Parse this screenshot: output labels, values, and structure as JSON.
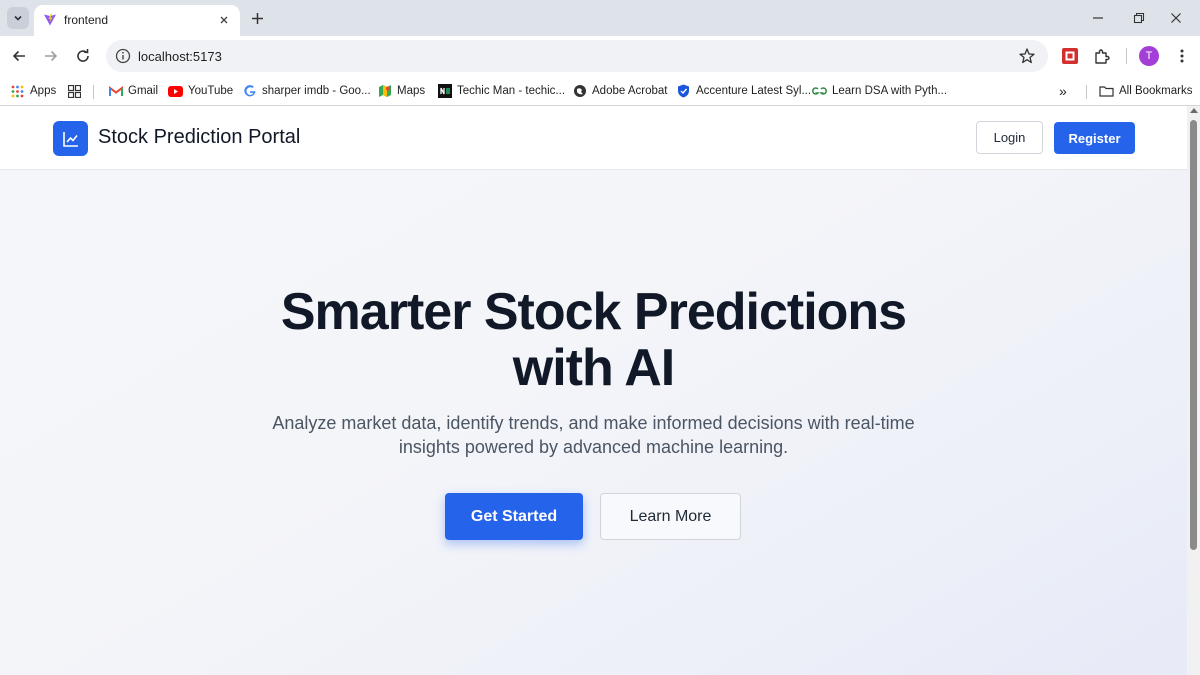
{
  "browser": {
    "tab_title": "frontend",
    "url": "localhost:5173",
    "profile_initial": "T"
  },
  "bookmarks": {
    "apps": "Apps",
    "items": [
      "Gmail",
      "YouTube",
      "sharper imdb - Goo...",
      "Maps",
      "Techic Man - techic...",
      "Adobe Acrobat",
      "Accenture Latest Syl...",
      "Learn DSA with Pyth..."
    ],
    "all_bookmarks": "All Bookmarks",
    "overflow": "»"
  },
  "navbar": {
    "brand": "Stock Prediction Portal",
    "login_label": "Login",
    "register_label": "Register"
  },
  "hero": {
    "title_line1": "Smarter Stock Predictions",
    "title_line2": "with AI",
    "subtitle_line1": "Analyze market data, identify trends, and make informed decisions with real-time",
    "subtitle_line2": "insights powered by advanced machine learning.",
    "primary_cta": "Get Started",
    "secondary_cta": "Learn More"
  },
  "colors": {
    "accent": "#2563eb",
    "heading": "#111827",
    "body_text": "#4b5563"
  }
}
